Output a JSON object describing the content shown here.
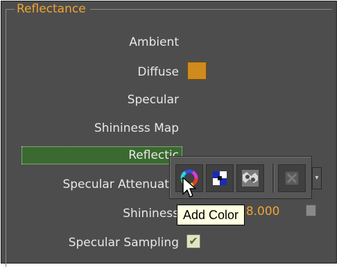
{
  "group": {
    "title": "Reflectance"
  },
  "rows": [
    {
      "label": "Ambient"
    },
    {
      "label": "Diffuse"
    },
    {
      "label": "Specular"
    },
    {
      "label": "Shininess Map"
    },
    {
      "label": "Reflectic"
    },
    {
      "label": "Specular Attenuatic"
    },
    {
      "label": "Shininess"
    },
    {
      "label": "Specular Sampling"
    }
  ],
  "shininess": {
    "value": "28.000"
  },
  "specular_sampling": {
    "checked": true,
    "check_glyph": "✔"
  },
  "toolbar": {
    "buttons": [
      {
        "icon": "add-color-icon"
      },
      {
        "icon": "add-texture-icon"
      },
      {
        "icon": "add-map-icon"
      },
      {
        "icon": "delete-icon"
      }
    ]
  },
  "tooltip": {
    "text": "Add Color"
  },
  "colors": {
    "panel_bg": "#4d4d4d",
    "accent_orange": "#f0a431",
    "highlight_green": "#3a6a2f",
    "label_text": "#e8e8e8",
    "swatch": "#d08a1e"
  }
}
